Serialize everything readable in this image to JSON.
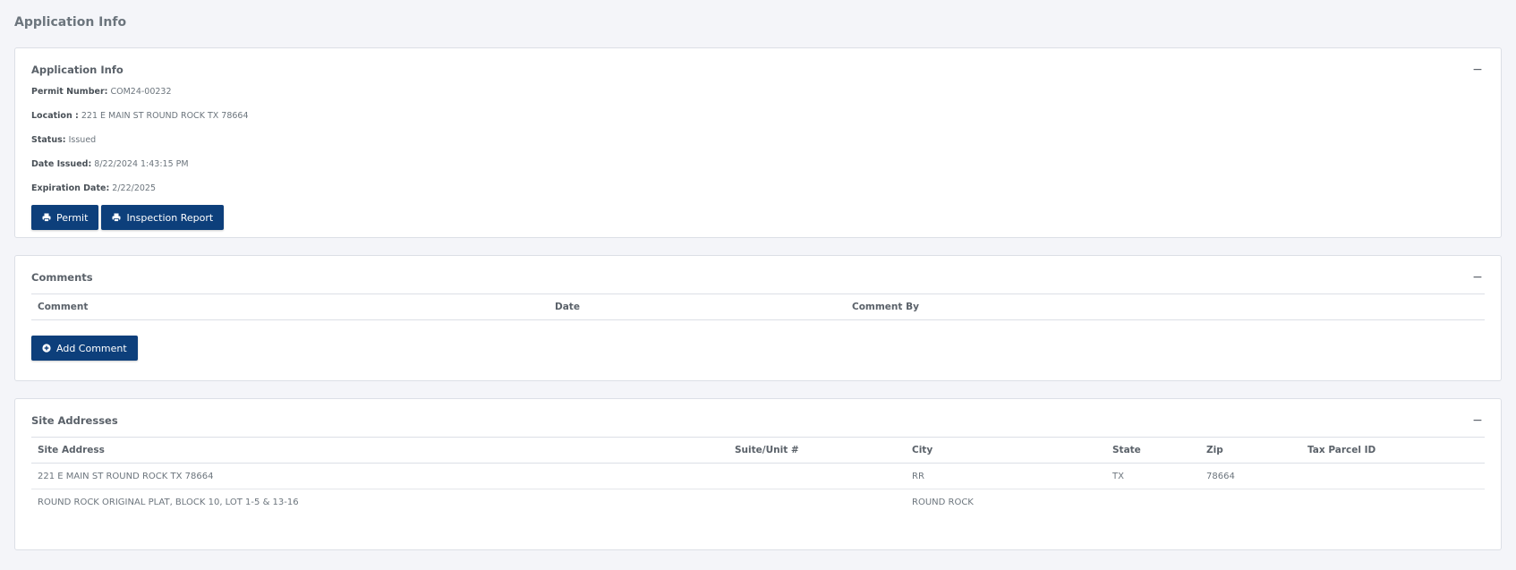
{
  "page": {
    "title": "Application Info"
  },
  "app_info": {
    "title": "Application Info",
    "collapse_glyph": "−",
    "fields": [
      {
        "label": "Permit Number:",
        "value": "COM24-00232"
      },
      {
        "label": "Location :",
        "value": "221 E MAIN ST ROUND ROCK TX 78664"
      },
      {
        "label": "Status:",
        "value": "Issued"
      },
      {
        "label": "Date Issued:",
        "value": "8/22/2024 1:43:15 PM"
      },
      {
        "label": "Expiration Date:",
        "value": "2/22/2025"
      }
    ],
    "buttons": [
      {
        "label": "Permit",
        "icon": "printer-icon"
      },
      {
        "label": "Inspection Report",
        "icon": "printer-icon"
      }
    ]
  },
  "comments": {
    "title": "Comments",
    "collapse_glyph": "−",
    "columns": [
      "Comment",
      "Date",
      "Comment By"
    ],
    "rows": [],
    "add_button": {
      "label": "Add Comment",
      "icon": "plus-circle-icon"
    }
  },
  "site_addresses": {
    "title": "Site Addresses",
    "collapse_glyph": "−",
    "columns": [
      "Site Address",
      "Suite/Unit #",
      "City",
      "State",
      "Zip",
      "Tax Parcel ID"
    ],
    "rows": [
      [
        "221 E MAIN ST ROUND ROCK TX 78664",
        "",
        "RR",
        "TX",
        "78664",
        ""
      ],
      [
        "ROUND ROCK ORIGINAL PLAT, BLOCK 10, LOT 1-5 & 13-16",
        "",
        "ROUND ROCK",
        "",
        "",
        ""
      ]
    ]
  },
  "colors": {
    "accent": "#0d3f7b",
    "background": "#f4f5f9",
    "card_border": "#dcdfe6"
  }
}
